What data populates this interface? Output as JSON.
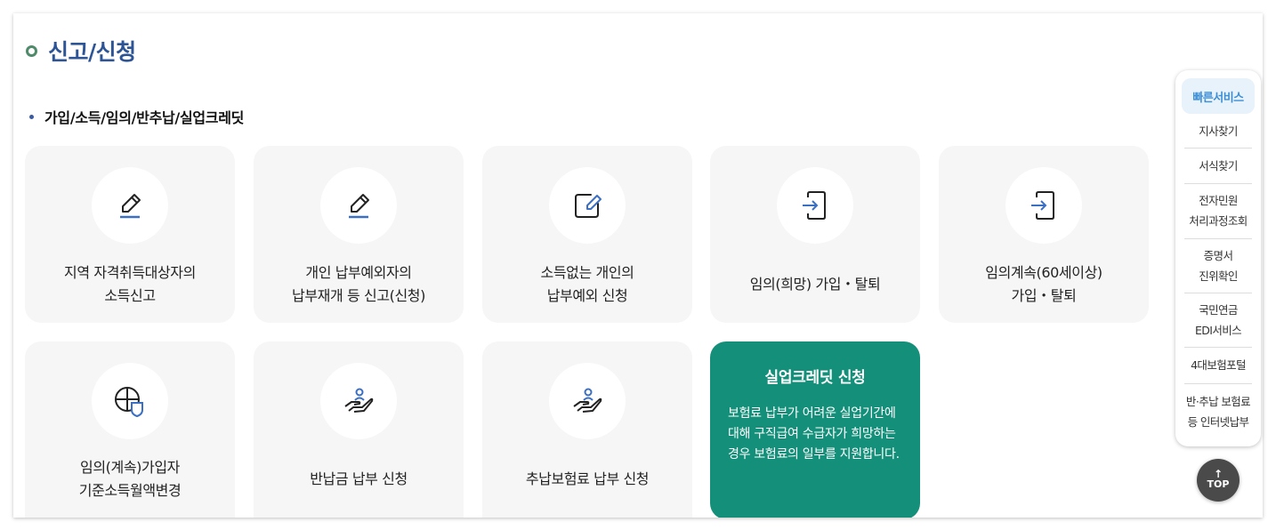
{
  "page": {
    "title": "신고/신청"
  },
  "section": {
    "title": "가입/소득/임의/반추납/실업크레딧"
  },
  "cards": [
    {
      "line1": "지역 자격취득대상자의",
      "line2": "소득신고",
      "icon": "pencil-icon"
    },
    {
      "line1": "개인 납부예외자의",
      "line2": "납부재개 등 신고(신청)",
      "icon": "pencil-icon"
    },
    {
      "line1": "소득없는 개인의",
      "line2": "납부예외 신청",
      "icon": "edit-box-icon"
    },
    {
      "line1": "임의(희망) 가입・탈퇴",
      "icon": "login-arrow-icon"
    },
    {
      "line1": "임의계속(60세이상)",
      "line2": "가입・탈퇴",
      "icon": "login-arrow-icon"
    },
    {
      "line1": "임의(계속)가입자",
      "line2": "기준소득월액변경",
      "icon": "globe-shield-icon"
    },
    {
      "line1": "반납금 납부 신청",
      "icon": "hand-person-icon"
    },
    {
      "line1": "추납보험료 납부 신청",
      "icon": "hand-person-icon"
    }
  ],
  "highlight": {
    "title": "실업크레딧 신청",
    "description": "보험료 납부가 어려운 실업기간에 대해 구직급여 수급자가 희망하는 경우 보험료의 일부를 지원합니다."
  },
  "quick_menu": {
    "title": "빠른서비스",
    "items": [
      {
        "line1": "지사찾기"
      },
      {
        "line1": "서식찾기"
      },
      {
        "line1": "전자민원",
        "line2": "처리과정조회"
      },
      {
        "line1": "증명서",
        "line2": "진위확인"
      },
      {
        "line1": "국민연금",
        "line2": "EDI서비스"
      },
      {
        "line1": "4대보험포털"
      },
      {
        "line1": "반·추납 보험료",
        "line2": "등 인터넷납부"
      }
    ]
  },
  "top_button": {
    "arrow": "↑",
    "label": "TOP"
  },
  "colors": {
    "title": "#2d5596",
    "accent_green": "#14907a",
    "icon_blue": "#3a6fc4",
    "quick_head_text": "#3c8fd6"
  }
}
